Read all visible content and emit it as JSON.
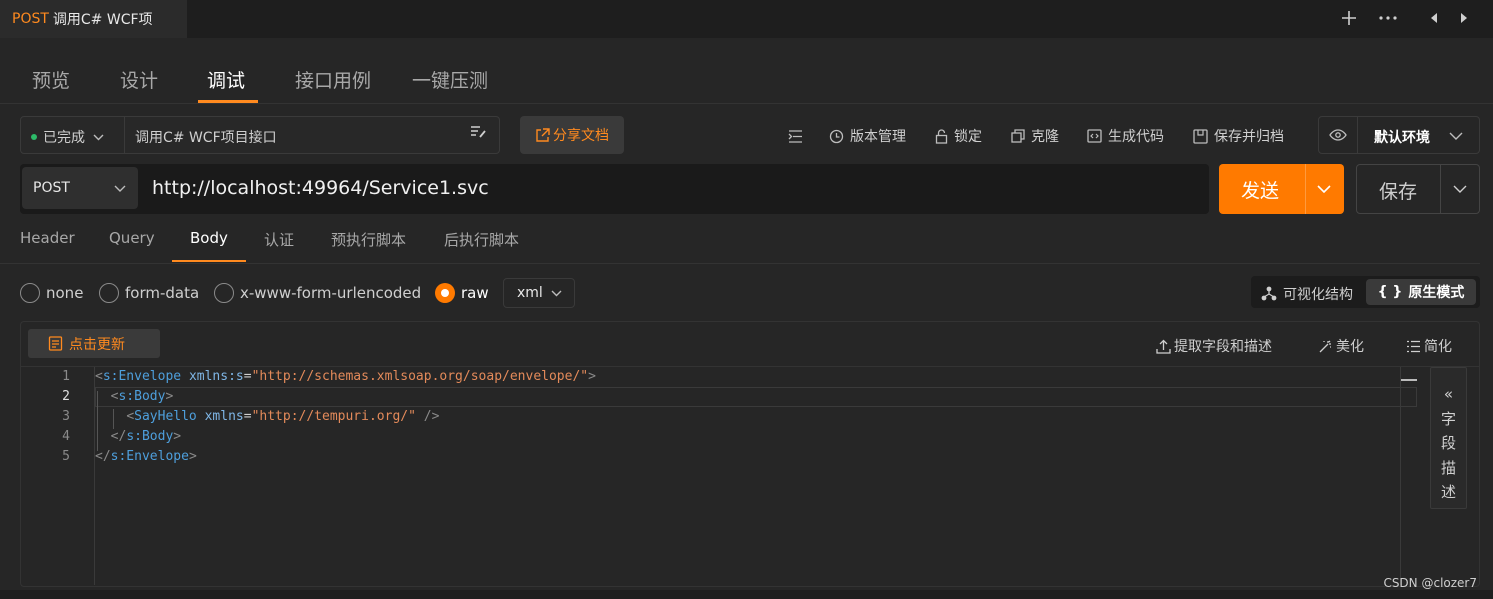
{
  "tab": {
    "method": "POST",
    "title": "调用C# WCF项"
  },
  "titlebar_icons": [
    "plus-icon",
    "more-icon",
    "prev-icon",
    "next-icon"
  ],
  "nav": {
    "tabs": [
      "预览",
      "设计",
      "调试",
      "接口用例",
      "一键压测"
    ],
    "active": "调试"
  },
  "status": {
    "label": "已完成",
    "name": "调用C# WCF项目接口"
  },
  "share_label": "分享文档",
  "actions": {
    "version": "版本管理",
    "lock": "锁定",
    "clone": "克隆",
    "gencode": "生成代码",
    "save_archive": "保存并归档"
  },
  "env": {
    "label": "默认环境"
  },
  "request": {
    "method": "POST",
    "url": "http://localhost:49964/Service1.svc",
    "send": "发送",
    "save": "保存"
  },
  "req_tabs": {
    "items": [
      "Header",
      "Query",
      "Body",
      "认证",
      "预执行脚本",
      "后执行脚本"
    ],
    "active": "Body"
  },
  "body_types": {
    "none": "none",
    "form_data": "form-data",
    "urlencoded": "x-www-form-urlencoded",
    "raw": "raw",
    "selected": "raw",
    "format": "xml"
  },
  "modes": {
    "visual": "可视化结构",
    "raw": "原生模式",
    "raw_icon": "{ }"
  },
  "editor": {
    "update": "点击更新",
    "extract": "提取字段和描述",
    "beautify": "美化",
    "simplify": "简化",
    "line_numbers": [
      "1",
      "2",
      "3",
      "4",
      "5"
    ],
    "current_line": "2",
    "lines": {
      "l1_tag": "s:Envelope",
      "l1_attr": "xmlns:s",
      "l1_val": "\"http://schemas.xmlsoap.org/soap/envelope/\"",
      "l2_tag": "s:Body",
      "l3_tag": "SayHello",
      "l3_attr": "xmlns",
      "l3_val": "\"http://tempuri.org/\"",
      "l4_tag": "s:Body",
      "l5_tag": "s:Envelope"
    }
  },
  "field_panel": {
    "chevron": "«",
    "chars": [
      "字",
      "段",
      "描",
      "述"
    ]
  },
  "watermark": "CSDN @clozer7",
  "colors": {
    "accent": "#ff7a00",
    "success": "#2dbb69",
    "bg": "#262626"
  }
}
